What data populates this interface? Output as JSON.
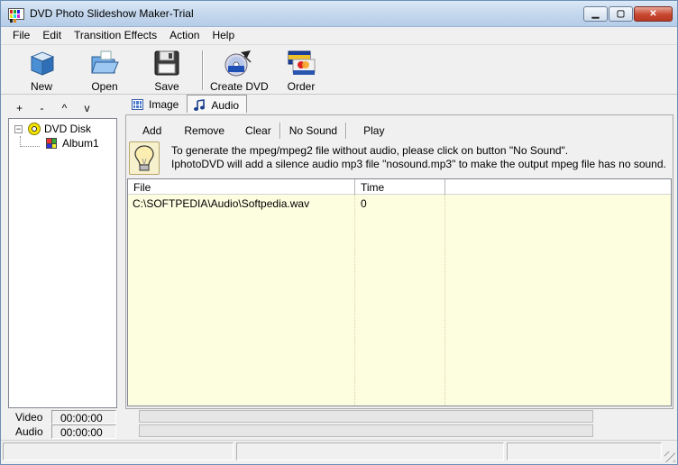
{
  "window": {
    "title": "DVD Photo Slideshow Maker-Trial",
    "minimize": "▁",
    "maximize": "▢",
    "close": "✕"
  },
  "menu": [
    "File",
    "Edit",
    "Transition Effects",
    "Action",
    "Help"
  ],
  "toolbar": {
    "new": "New",
    "open": "Open",
    "save": "Save",
    "create_dvd": "Create DVD",
    "order": "Order"
  },
  "left": {
    "tools": [
      "+",
      "-",
      "^",
      "v"
    ],
    "tree": {
      "root_expander": "−",
      "root": "DVD Disk",
      "child": "Album1"
    },
    "status": [
      {
        "label": "Video",
        "value": "00:00:00"
      },
      {
        "label": "Audio",
        "value": "00:00:00"
      }
    ]
  },
  "tabs": {
    "image": "Image",
    "audio": "Audio",
    "active": "audio"
  },
  "audio_panel": {
    "buttons": [
      "Add",
      "Remove",
      "Clear",
      "No Sound",
      "Play"
    ],
    "info_lines": [
      "To generate the mpeg/mpeg2 file without audio, please click on button \"No Sound\".",
      "IphotoDVD will add a silence audio mp3 file \"nosound.mp3\"  to make the output mpeg file has no sound."
    ],
    "columns": [
      "File",
      "Time"
    ],
    "rows": [
      {
        "file": "C:\\SOFTPEDIA\\Audio\\Softpedia.wav",
        "time": "0"
      }
    ]
  }
}
